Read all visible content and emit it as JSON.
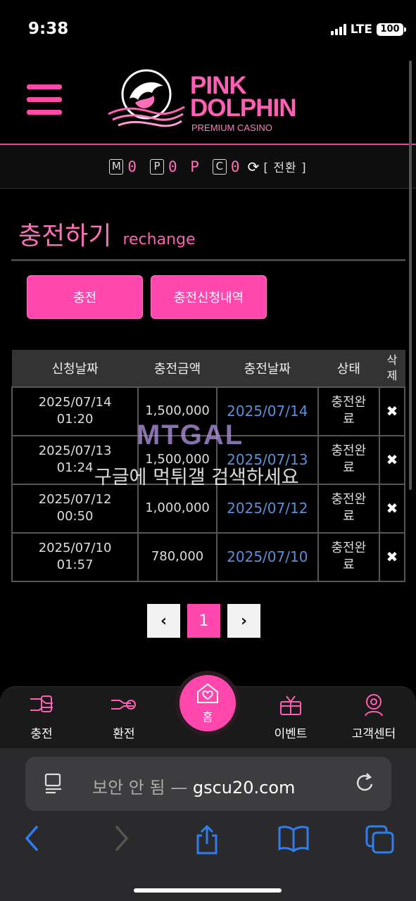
{
  "status_bar": {
    "time": "9:38",
    "network": "LTE",
    "battery": "100"
  },
  "header": {
    "logo_line1": "PINK",
    "logo_line2": "DOLPHIN",
    "logo_line3": "PREMIUM CASINO"
  },
  "points": {
    "m_label": "M",
    "m_value": "0",
    "p_label": "P",
    "p_value": "0 P",
    "c_label": "C",
    "c_value": "0",
    "switch_label": "[ 전환 ]"
  },
  "page_title": {
    "korean": "충전하기",
    "english": "rechange"
  },
  "buttons": {
    "charge": "충전",
    "history": "충전신청내역"
  },
  "table": {
    "headers": [
      "신청날짜",
      "충전금액",
      "충전날짜",
      "상태",
      "삭제"
    ],
    "rows": [
      {
        "request_date": "2025/07/14",
        "request_time": "01:20",
        "amount": "1,500,000",
        "charge_date": "2025/07/14",
        "status": "충전완료",
        "delete": "✖"
      },
      {
        "request_date": "2025/07/13",
        "request_time": "01:24",
        "amount": "1,500,000",
        "charge_date": "2025/07/13",
        "status": "충전완료",
        "delete": "✖"
      },
      {
        "request_date": "2025/07/12",
        "request_time": "00:50",
        "amount": "1,000,000",
        "charge_date": "2025/07/12",
        "status": "충전완료",
        "delete": "✖"
      },
      {
        "request_date": "2025/07/10",
        "request_time": "01:57",
        "amount": "780,000",
        "charge_date": "2025/07/10",
        "status": "충전완료",
        "delete": "✖"
      }
    ]
  },
  "watermark": {
    "logo": "MTGAL",
    "text": "구글에 먹튀갤 검색하세요"
  },
  "pagination": {
    "prev": "‹",
    "current": "1",
    "next": "›"
  },
  "bottom_nav": {
    "charge": "충전",
    "exchange": "환전",
    "home": "홈",
    "event": "이벤트",
    "support": "고객센터"
  },
  "browser": {
    "security": "보안 안 됨 — ",
    "domain": "gscu20.com"
  },
  "colors": {
    "accent": "#ff47ad",
    "link_date": "#5b8fd8",
    "background": "#000000"
  }
}
